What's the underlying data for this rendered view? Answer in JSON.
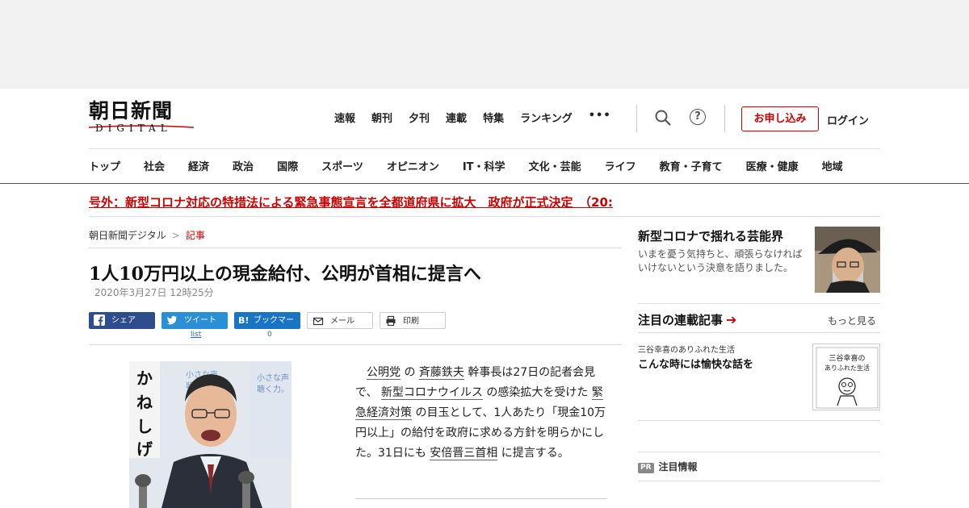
{
  "header": {
    "logo_main": "朝日新聞",
    "logo_sub": "DIGITAL",
    "top_nav": [
      "速報",
      "朝刊",
      "夕刊",
      "連載",
      "特集",
      "ランキング"
    ],
    "more_label": "•••",
    "help_label": "?",
    "apply_label": "お申し込み",
    "login_label": "ログイン"
  },
  "categories": [
    "トップ",
    "社会",
    "経済",
    "政治",
    "国際",
    "スポーツ",
    "オピニオン",
    "IT・科学",
    "文化・芸能",
    "ライフ",
    "教育・子育て",
    "医療・健康",
    "地域"
  ],
  "breaking": "号外：新型コロナ対応の特措法による緊急事態宣言を全都道府県に拡大　政府が正式決定　（20:",
  "breadcrumb": {
    "home": "朝日新聞デジタル",
    "separator": ">",
    "current": "記事"
  },
  "article": {
    "headline": "1人10万円以上の現金給付、公明が首相に提言へ",
    "date": "2020年3月27日 12時25分",
    "share": {
      "facebook": "シェア",
      "twitter": "ツイート",
      "twitter_count": "list",
      "hatena": "ブックマーク",
      "hatena_icon": "B!",
      "hatena_count": "0",
      "mail": "メール",
      "print": "印刷"
    },
    "photo_text": {
      "name": "かねしげ",
      "poster_1": "小さな声",
      "poster_2": "聴く力。",
      "poster_3": "小さな声",
      "poster_4": "聴く力。"
    },
    "body": {
      "t1": "公明党",
      "t2": "の",
      "t3": "斉藤鉄夫",
      "t4": "幹事長は27日の記者会見で、",
      "t5": "新型コロナウイルス",
      "t6": "の感染拡大を受けた",
      "t7": "緊急経済対策",
      "t8": "の目玉として、1人あたり「現金10万円以上」の給付を政府に求める方針を明らかにした。31日にも",
      "t9": "安倍晋三首相",
      "t10": "に提言する。"
    }
  },
  "sidebar": {
    "feature_title": "新型コロナで揺れる芸能界",
    "feature_desc": "いまを憂う気持ちと、頑張らなければいけないという決意を語りました。",
    "series_title": "注目の連載記事",
    "series_arrow": "➔",
    "more_label": "もっと見る",
    "series_sub": "三谷幸喜のありふれた生活",
    "series_headline": "こんな時には愉快な話を",
    "series_thumb_line1": "三谷幸喜の",
    "series_thumb_line2": "ありふれた生活",
    "pr_tag": "PR",
    "pr_label": "注目情報"
  },
  "colors": {
    "accent_red": "#cc0000",
    "facebook": "#2d4d8c",
    "twitter": "#2b8fd5",
    "hatena": "#1a74c4"
  }
}
